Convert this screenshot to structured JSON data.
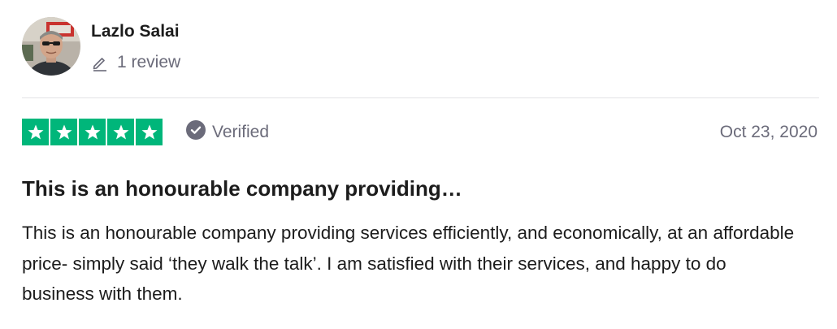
{
  "reviewer": {
    "name": "Lazlo Salai",
    "review_count": "1 review",
    "avatar_icon": "user-photo-avatar"
  },
  "review": {
    "rating": 5,
    "rating_max": 5,
    "star_color": "#00b67a",
    "verified_label": "Verified",
    "verified_icon": "check-badge-icon",
    "date": "Oct 23, 2020",
    "title": "This is an honourable company providing…",
    "body": "This is an honourable company providing services efficiently, and economically, at an affordable price- simply said ‘they walk the talk’. I am satisfied with their services, and happy to do business with them."
  }
}
